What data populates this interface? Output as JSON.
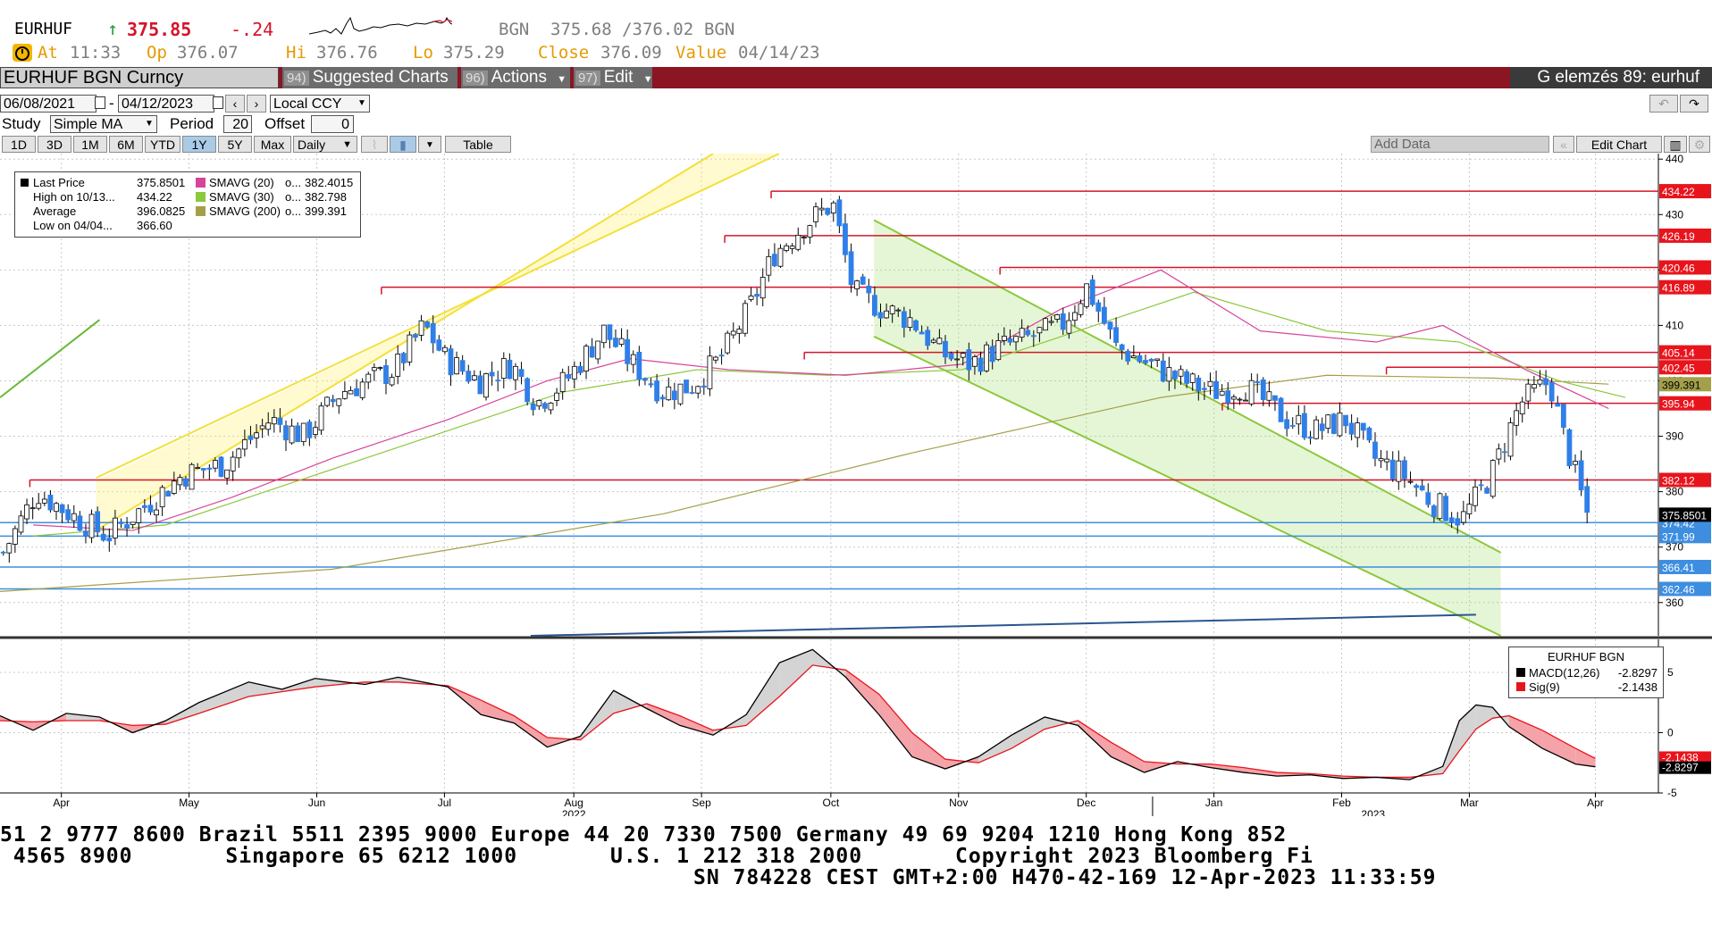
{
  "header": {
    "symbol": "EURHUF",
    "last_arrow": "↑",
    "last_price": "375.85",
    "change": "-.24",
    "source_label": "BGN",
    "bid_ask": "375.68 /376.02",
    "source_label2": "BGN",
    "at_label": "At",
    "at_time": "11:33",
    "open_label": "Op",
    "open_value": "376.07",
    "hi_label": "Hi",
    "hi_value": "376.76",
    "lo_label": "Lo",
    "lo_value": "375.29",
    "close_label": "Close",
    "close_value": "376.09",
    "value_label": "Value",
    "value_date": "04/14/23"
  },
  "toolbar": {
    "security": "EURHUF BGN Curncy",
    "suggested_num": "94)",
    "suggested_label": "Suggested Charts",
    "actions_num": "96)",
    "actions_label": "Actions",
    "edit_num": "97)",
    "edit_label": "Edit",
    "right_title": "G elemzés 89: eurhuf"
  },
  "controls": {
    "date_from": "06/08/2021",
    "date_to": "04/12/2023",
    "currency": "Local CCY",
    "study_label": "Study",
    "study_value": "Simple MA",
    "period_label": "Period",
    "period_value": "20",
    "offset_label": "Offset",
    "offset_value": "0",
    "ranges": [
      "1D",
      "3D",
      "1M",
      "6M",
      "YTD",
      "1Y",
      "5Y",
      "Max"
    ],
    "active_range": "1Y",
    "frequency": "Daily",
    "table_label": "Table",
    "add_data_placeholder": "Add Data",
    "edit_chart_label": "Edit Chart"
  },
  "legend_main": {
    "rows": [
      {
        "label": "Last Price",
        "value": "375.8501",
        "color": "#000000"
      },
      {
        "label": "High on 10/13...",
        "value": "434.22",
        "color": "#000000"
      },
      {
        "label": "Average",
        "value": "396.0825",
        "color": "#000000"
      },
      {
        "label": "Low on 04/04...",
        "value": "366.60",
        "color": "#000000"
      }
    ],
    "ma_rows": [
      {
        "label": "SMAVG (20)",
        "flag": "o...",
        "value": "382.4015",
        "color": "#d6449b"
      },
      {
        "label": "SMAVG (30)",
        "flag": "o...",
        "value": "382.798",
        "color": "#8cc83c"
      },
      {
        "label": "SMAVG (200)",
        "flag": "o...",
        "value": "399.391",
        "color": "#a4a04a"
      }
    ]
  },
  "legend_macd": {
    "title": "EURHUF BGN",
    "rows": [
      {
        "label": "MACD(12,26)",
        "value": "-2.8297",
        "color": "#000000"
      },
      {
        "label": "Sig(9)",
        "value": "-2.1438",
        "color": "#e8141c"
      }
    ]
  },
  "chart_data": {
    "type": "candlestick",
    "title": "EURHUF BGN Curncy",
    "x_tick_labels": [
      "Apr",
      "May",
      "Jun",
      "Jul",
      "Aug",
      "Sep",
      "Oct",
      "Nov",
      "Dec",
      "Jan",
      "Feb",
      "Mar",
      "Apr"
    ],
    "year_labels": [
      "2022",
      "2023"
    ],
    "y_ticks": [
      360,
      370,
      380,
      390,
      400,
      410,
      420,
      430,
      440
    ],
    "ylim": [
      354,
      441
    ],
    "horizontal_levels": {
      "resistance_red": [
        "434.22",
        "426.19",
        "420.46",
        "416.89",
        "405.14",
        "402.45",
        "395.94",
        "382.12"
      ],
      "support_blue": [
        "374.42",
        "371.99",
        "366.41",
        "362.46"
      ],
      "sma200_label": "399.391",
      "last_label": "375.8501"
    },
    "price_series": {
      "name": "Last Price",
      "points": [
        [
          "2022-03-28",
          369
        ],
        [
          "2022-04-05",
          380
        ],
        [
          "2022-04-15",
          375
        ],
        [
          "2022-04-22",
          372
        ],
        [
          "2022-05-02",
          378
        ],
        [
          "2022-05-10",
          383
        ],
        [
          "2022-05-20",
          385
        ],
        [
          "2022-05-31",
          393
        ],
        [
          "2022-06-08",
          390
        ],
        [
          "2022-06-17",
          398
        ],
        [
          "2022-06-30",
          402
        ],
        [
          "2022-07-07",
          410
        ],
        [
          "2022-07-12",
          404
        ],
        [
          "2022-07-20",
          400
        ],
        [
          "2022-07-28",
          403
        ],
        [
          "2022-08-03",
          396
        ],
        [
          "2022-08-10",
          400
        ],
        [
          "2022-08-19",
          409
        ],
        [
          "2022-08-26",
          403
        ],
        [
          "2022-09-02",
          398
        ],
        [
          "2022-09-09",
          399
        ],
        [
          "2022-09-16",
          404
        ],
        [
          "2022-09-23",
          413
        ],
        [
          "2022-09-29",
          423
        ],
        [
          "2022-10-06",
          428
        ],
        [
          "2022-10-13",
          432
        ],
        [
          "2022-10-18",
          416
        ],
        [
          "2022-10-25",
          413
        ],
        [
          "2022-11-01",
          411
        ],
        [
          "2022-11-08",
          405
        ],
        [
          "2022-11-15",
          403
        ],
        [
          "2022-11-22",
          406
        ],
        [
          "2022-11-30",
          408
        ],
        [
          "2022-12-07",
          410
        ],
        [
          "2022-12-13",
          417
        ],
        [
          "2022-12-20",
          406
        ],
        [
          "2022-12-28",
          403
        ],
        [
          "2023-01-05",
          400
        ],
        [
          "2023-01-12",
          398
        ],
        [
          "2023-01-20",
          399
        ],
        [
          "2023-01-30",
          393
        ],
        [
          "2023-02-06",
          391
        ],
        [
          "2023-02-13",
          393
        ],
        [
          "2023-02-20",
          386
        ],
        [
          "2023-02-27",
          383
        ],
        [
          "2023-03-06",
          378
        ],
        [
          "2023-03-13",
          375
        ],
        [
          "2023-03-20",
          383
        ],
        [
          "2023-03-27",
          396
        ],
        [
          "2023-04-03",
          400
        ],
        [
          "2023-04-06",
          391
        ],
        [
          "2023-04-12",
          376
        ]
      ]
    },
    "sma20": [
      [
        0.02,
        374
      ],
      [
        0.08,
        373
      ],
      [
        0.14,
        379
      ],
      [
        0.2,
        386
      ],
      [
        0.27,
        393
      ],
      [
        0.33,
        400
      ],
      [
        0.38,
        404
      ],
      [
        0.44,
        402
      ],
      [
        0.51,
        401
      ],
      [
        0.58,
        403
      ],
      [
        0.64,
        413
      ],
      [
        0.7,
        420
      ],
      [
        0.76,
        409
      ],
      [
        0.83,
        407
      ],
      [
        0.87,
        410
      ],
      [
        0.92,
        402
      ],
      [
        0.97,
        395
      ]
    ],
    "sma30": [
      [
        0.02,
        372
      ],
      [
        0.1,
        374
      ],
      [
        0.18,
        382
      ],
      [
        0.26,
        390
      ],
      [
        0.34,
        398
      ],
      [
        0.42,
        402
      ],
      [
        0.5,
        401
      ],
      [
        0.58,
        402
      ],
      [
        0.66,
        410
      ],
      [
        0.72,
        416
      ],
      [
        0.8,
        409
      ],
      [
        0.88,
        407
      ],
      [
        0.94,
        400
      ],
      [
        0.98,
        397
      ]
    ],
    "sma200": [
      [
        0.0,
        362
      ],
      [
        0.2,
        366
      ],
      [
        0.4,
        376
      ],
      [
        0.55,
        387
      ],
      [
        0.7,
        397
      ],
      [
        0.8,
        401
      ],
      [
        0.9,
        400.5
      ],
      [
        0.97,
        399.4
      ]
    ],
    "macd": {
      "y_ticks": [
        -5,
        0,
        5
      ],
      "ylim": [
        -5,
        7
      ],
      "macd_label": "-2.8297",
      "signal_label": "-2.1438"
    }
  }
}
